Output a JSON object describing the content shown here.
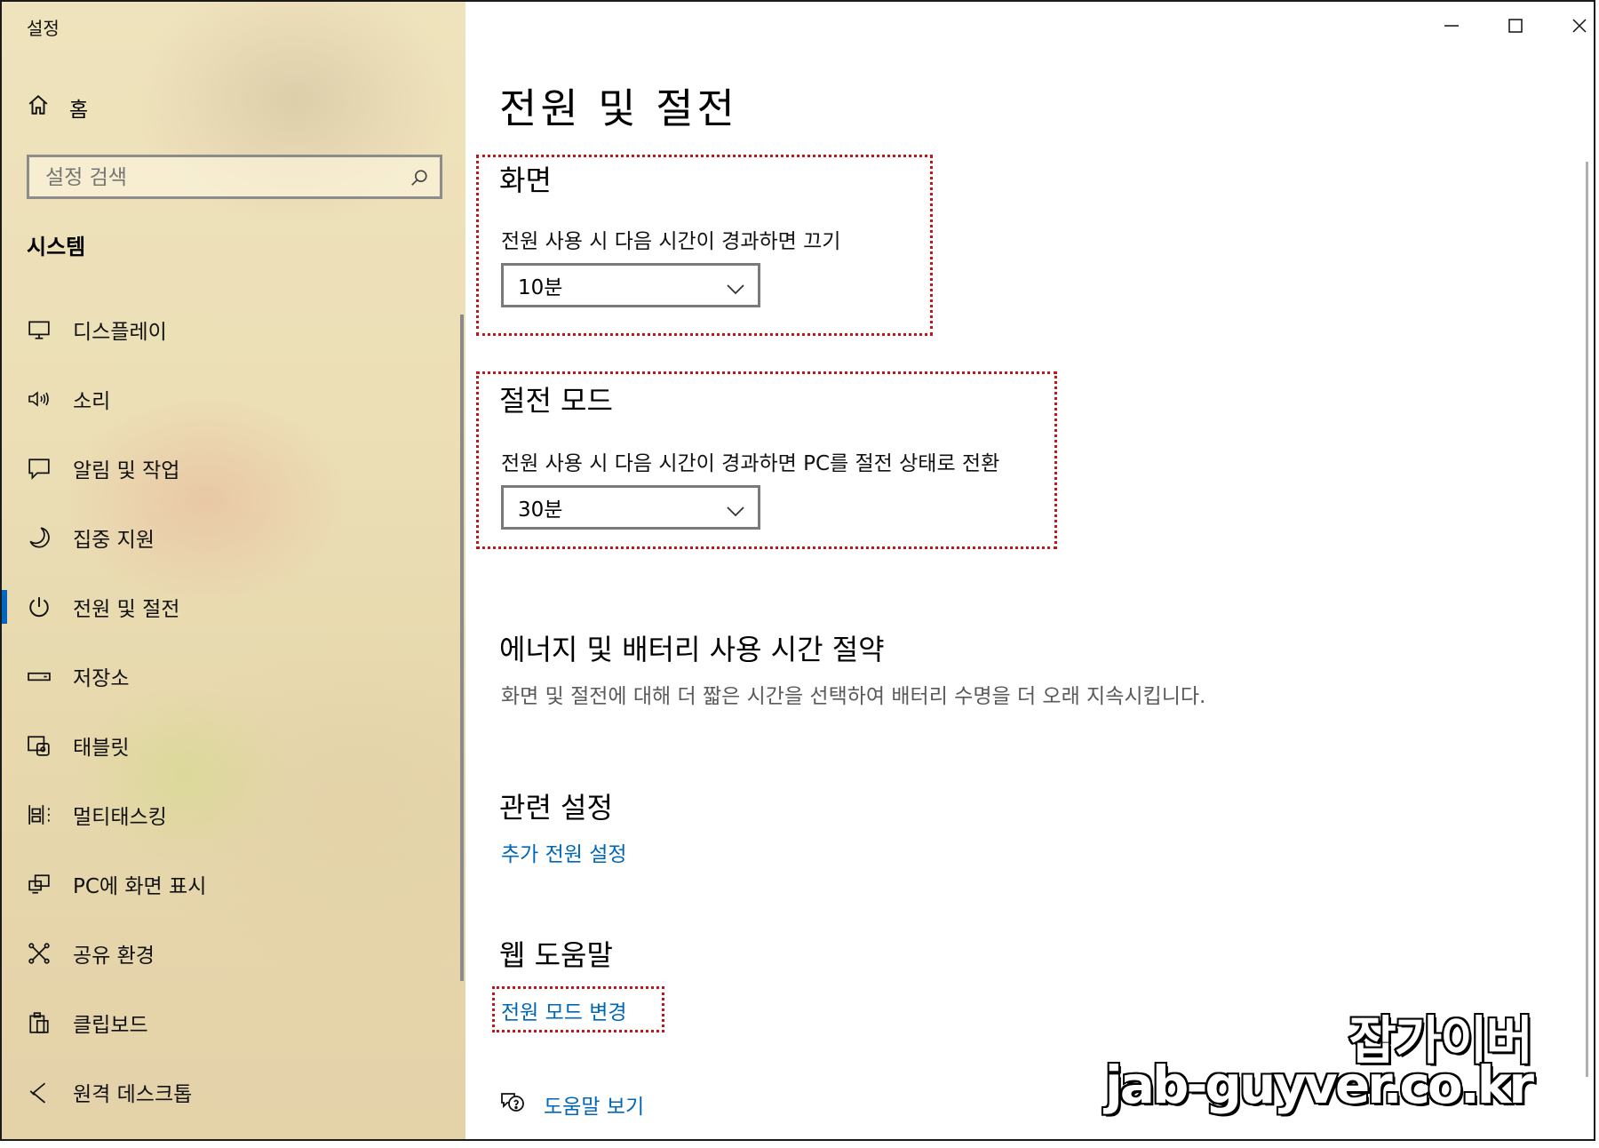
{
  "app": {
    "title": "설정"
  },
  "sidebar": {
    "home_label": "홈",
    "search_placeholder": "설정 검색",
    "section_title": "시스템",
    "items": [
      {
        "label": "디스플레이",
        "icon": "monitor-icon"
      },
      {
        "label": "소리",
        "icon": "speaker-icon"
      },
      {
        "label": "알림 및 작업",
        "icon": "message-icon"
      },
      {
        "label": "집중 지원",
        "icon": "moon-icon"
      },
      {
        "label": "전원 및 절전",
        "icon": "power-icon",
        "active": true
      },
      {
        "label": "저장소",
        "icon": "drive-icon"
      },
      {
        "label": "태블릿",
        "icon": "tablet-icon"
      },
      {
        "label": "멀티태스킹",
        "icon": "multitask-icon"
      },
      {
        "label": "PC에 화면 표시",
        "icon": "project-icon"
      },
      {
        "label": "공유 환경",
        "icon": "share-icon"
      },
      {
        "label": "클립보드",
        "icon": "clipboard-icon"
      },
      {
        "label": "원격 데스크톱",
        "icon": "remote-icon"
      }
    ]
  },
  "main": {
    "page_title": "전원 및 절전",
    "screen": {
      "heading": "화면",
      "description": "전원 사용 시 다음 시간이 경과하면 끄기",
      "value": "10분"
    },
    "sleep": {
      "heading": "절전 모드",
      "description": "전원 사용 시 다음 시간이 경과하면 PC를 절전 상태로 전환",
      "value": "30분"
    },
    "energy": {
      "heading": "에너지 및 배터리 사용 시간 절약",
      "description": "화면 및 절전에 대해 더 짧은 시간을 선택하여 배터리 수명을 더 오래 지속시킵니다."
    },
    "related": {
      "heading": "관련 설정",
      "link": "추가 전원 설정"
    },
    "web_help": {
      "heading": "웹 도움말",
      "link": "전원 모드 변경"
    },
    "help_link": "도움말 보기"
  },
  "watermark": {
    "line1": "잡가이버",
    "line2": "jab-guyver.co.kr"
  },
  "colors": {
    "accent": "#0067c0",
    "link": "#0067b8",
    "highlight": "#c01818"
  }
}
